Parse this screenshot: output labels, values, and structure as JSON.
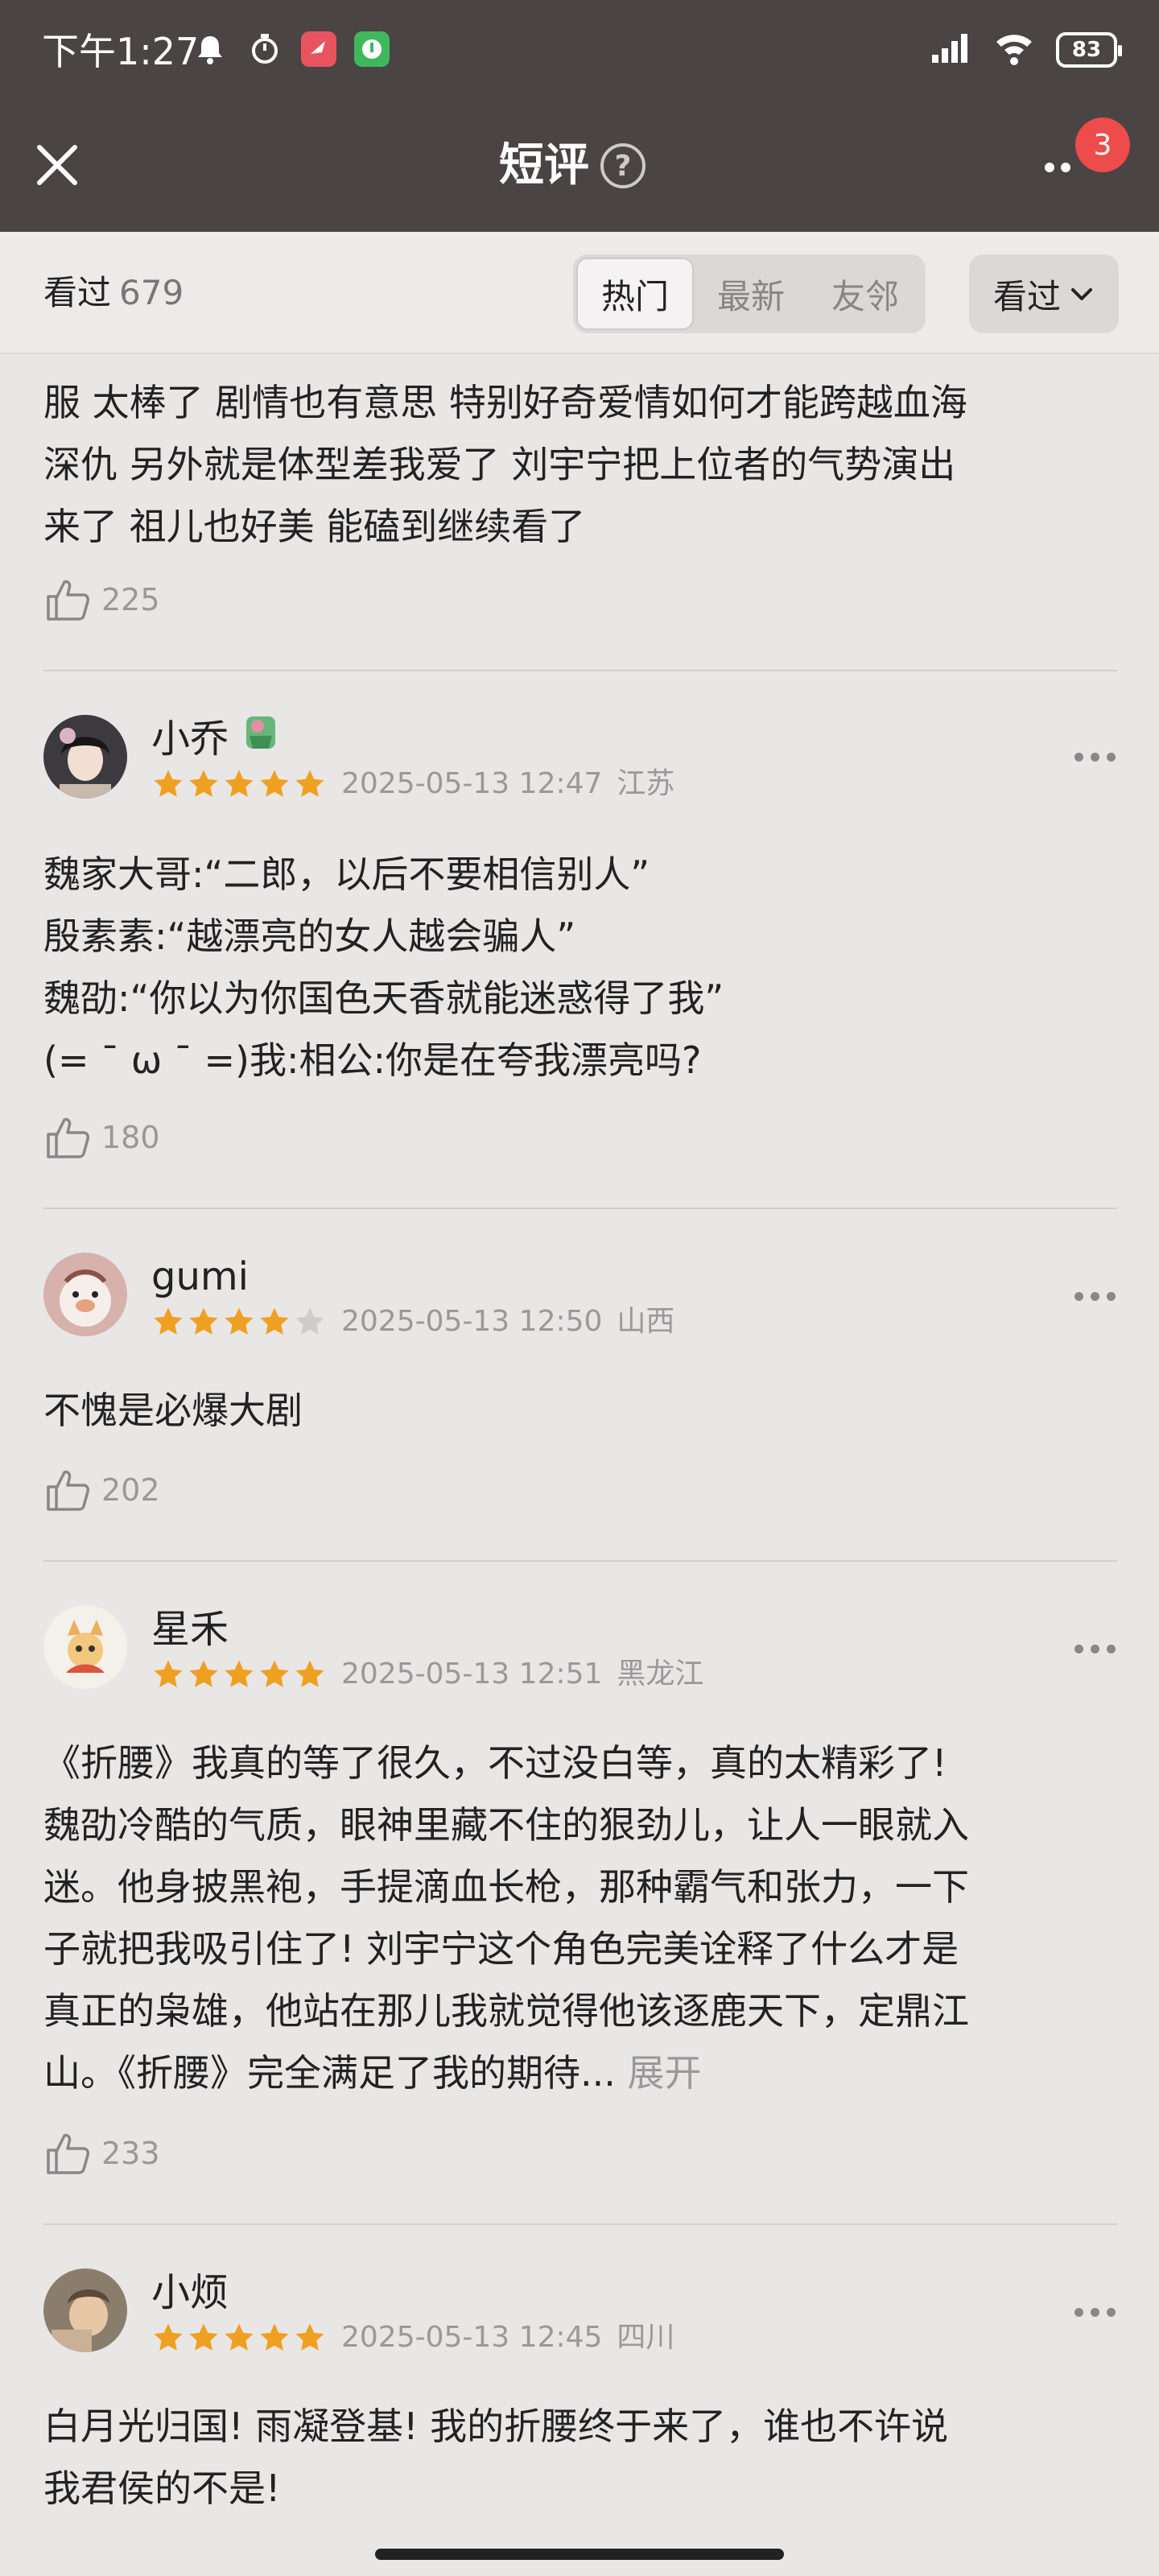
{
  "status": {
    "time": "下午1:27",
    "battery": "83"
  },
  "header": {
    "title": "短评",
    "help": "?",
    "badge": "3"
  },
  "filter": {
    "seen_label": "看过",
    "seen_count": "679",
    "tabs": [
      "热门",
      "最新",
      "友邻"
    ],
    "active_tab": "热门",
    "dropdown": "看过"
  },
  "comments": [
    {
      "text_lines": [
        "服 太棒了 剧情也有意思 特别好奇爱情如何才能跨越血海",
        "深仇 另外就是体型差我爱了 刘宇宁把上位者的气势演出",
        "来了 祖儿也好美 能磕到继续看了"
      ],
      "likes": "225"
    },
    {
      "user": "小乔",
      "rating": 5,
      "time": "2025-05-13 12:47",
      "location": "江苏",
      "text_lines": [
        "魏家大哥:“二郎，以后不要相信别人”",
        "殷素素:“越漂亮的女人越会骗人”",
        "魏劭:“你以为你国色天香就能迷惑得了我”",
        "(= ¯ ω ¯ =)我:相公:你是在夸我漂亮吗?"
      ],
      "likes": "180"
    },
    {
      "user": "gumi",
      "rating": 4,
      "time": "2025-05-13 12:50",
      "location": "山西",
      "text_lines": [
        "不愧是必爆大剧"
      ],
      "likes": "202"
    },
    {
      "user": "星禾",
      "rating": 5,
      "time": "2025-05-13 12:51",
      "location": "黑龙江",
      "text_lines": [
        "《折腰》我真的等了很久，不过没白等，真的太精彩了!",
        "魏劭冷酷的气质，眼神里藏不住的狠劲儿，让人一眼就入",
        "迷。他身披黑袍，手提滴血长枪，那种霸气和张力，一下",
        "子就把我吸引住了! 刘宇宁这个角色完美诠释了什么才是",
        "真正的枭雄，他站在那儿我就觉得他该逐鹿天下，定鼎江",
        "山。《折腰》完全满足了我的期待..."
      ],
      "expand": "展开",
      "likes": "233"
    },
    {
      "user": "小烦",
      "rating": 5,
      "time": "2025-05-13 12:45",
      "location": "四川",
      "text_lines": [
        "白月光归国! 雨凝登基! 我的折腰终于来了，谁也不许说",
        "我君侯的不是!"
      ]
    }
  ],
  "colors": {
    "header_bg": "#4a4444",
    "star": "#f0a020",
    "badge": "#ee4b4b"
  }
}
